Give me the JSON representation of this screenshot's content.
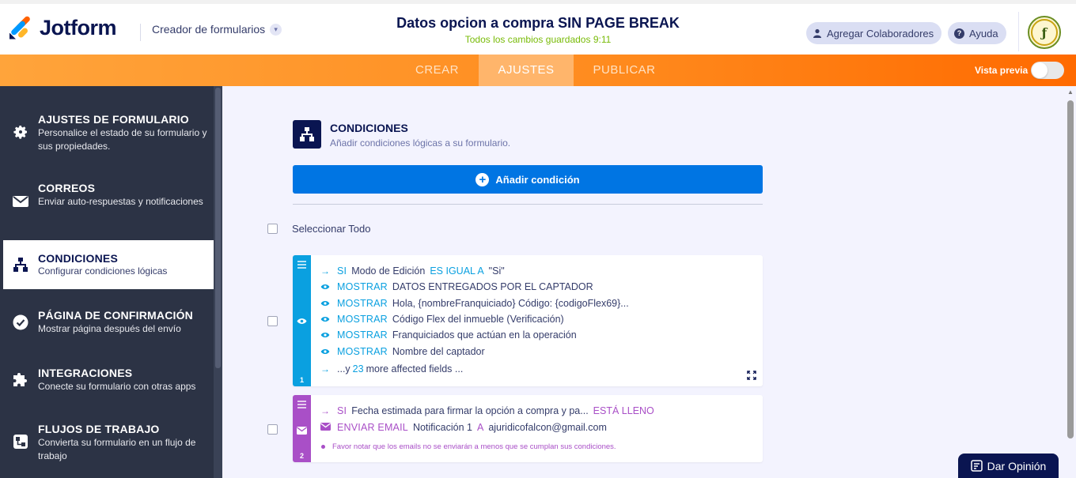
{
  "header": {
    "logo_text": "Jotform",
    "builder_label": "Creador de formularios",
    "form_title": "Datos opcion a compra SIN PAGE BREAK",
    "save_status": "Todos los cambios guardados 9:11",
    "collab_label": "Agregar Colaboradores",
    "help_label": "Ayuda"
  },
  "tabs": {
    "crear": "CREAR",
    "ajustes": "AJUSTES",
    "publicar": "PUBLICAR",
    "preview_label": "Vista previa"
  },
  "sidebar": {
    "items": [
      {
        "title": "AJUSTES DE FORMULARIO",
        "desc": "Personalice el estado de su formulario y sus propiedades.",
        "icon": "gear-icon"
      },
      {
        "title": "CORREOS",
        "desc": "Enviar auto-respuestas y notificaciones",
        "icon": "envelope-icon"
      },
      {
        "title": "CONDICIONES",
        "desc": "Configurar condiciones lógicas",
        "icon": "sitemap-icon"
      },
      {
        "title": "PÁGINA DE CONFIRMACIÓN",
        "desc": "Mostrar página después del envío",
        "icon": "check-circle-icon"
      },
      {
        "title": "INTEGRACIONES",
        "desc": "Conecte su formulario con otras apps",
        "icon": "puzzle-icon"
      },
      {
        "title": "FLUJOS DE TRABAJO",
        "desc": "Convierta su formulario en un flujo de trabajo",
        "icon": "workflow-icon"
      }
    ]
  },
  "main": {
    "heading": "CONDICIONES",
    "subheading": "Añadir condiciones lógicas a su formulario.",
    "add_button": "Añadir condición",
    "select_all": "Seleccionar Todo",
    "card1": {
      "number": "1",
      "if_kw": "SI",
      "if_field": "Modo de Edición",
      "if_op": "ES IGUAL A",
      "if_value": "\"Si\"",
      "show_kw": "MOSTRAR",
      "actions": [
        "DATOS ENTREGADOS POR EL CAPTADOR",
        "Hola, {nombreFranquiciado} Código: {codigoFlex69}...",
        "Código Flex del inmueble (Verificación)",
        "Franquiciados que actúan en la operación",
        "Nombre del captador"
      ],
      "more_prefix": "...y",
      "more_count": "23",
      "more_suffix": "more affected fields ..."
    },
    "card2": {
      "number": "2",
      "if_kw": "SI",
      "if_field": "Fecha estimada para firmar la opción a compra y pa...",
      "if_op": "ESTÁ LLENO",
      "action_kw": "ENVIAR EMAIL",
      "action_text": "Notificación 1",
      "action_op": "A",
      "action_target": "ajuridicofalcon@gmail.com",
      "note": "Favor notar que los emails no se enviarán a menos que se cumplan sus condiciones."
    }
  },
  "feedback_label": "Dar Opinión",
  "colors": {
    "accent_blue": "#0075e3",
    "orange": "#ff8c1f",
    "cond_blue": "#0aa0e0",
    "cond_purple": "#a94fc7",
    "navy": "#0a1551"
  }
}
